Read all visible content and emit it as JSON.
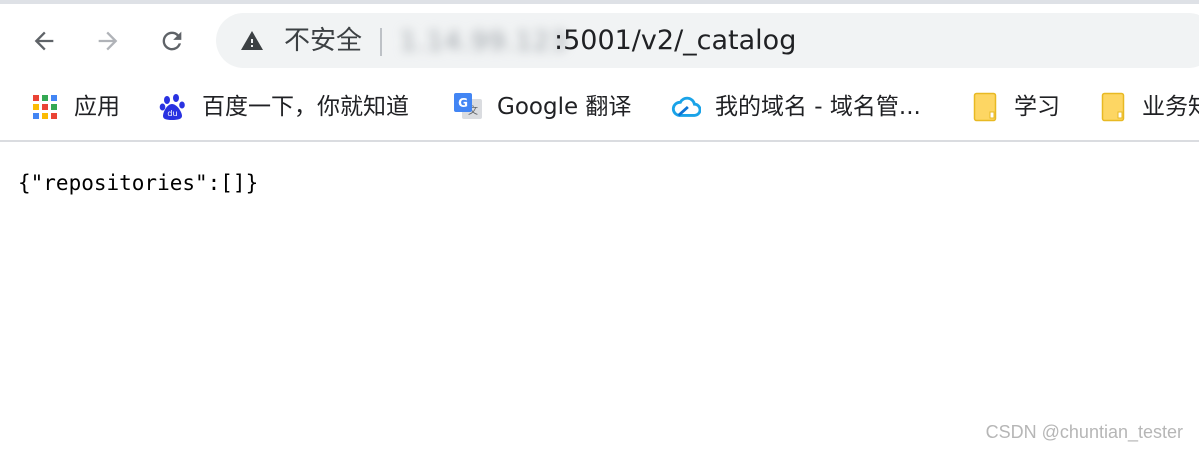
{
  "browser": {
    "address_bar": {
      "security_label": "不安全",
      "host_blurred": "1.14.99.123",
      "path": ":5001/v2/_catalog"
    },
    "bookmarks": [
      {
        "label": "应用",
        "icon": "apps-grid-icon"
      },
      {
        "label": "百度一下，你就知道",
        "icon": "baidu-paw-icon"
      },
      {
        "label": "Google 翻译",
        "icon": "google-translate-icon"
      },
      {
        "label": "我的域名 - 域名管...",
        "icon": "cloud-icon"
      },
      {
        "label": "学习",
        "icon": "folder-icon"
      },
      {
        "label": "业务知",
        "icon": "folder-icon"
      }
    ]
  },
  "page": {
    "json_text": "{\"repositories\":[]}"
  },
  "watermark": {
    "text": "CSDN @chuntian_tester"
  },
  "colors": {
    "toolbar_bg": "#ffffff",
    "omnibox_bg": "#f1f3f4",
    "icon_gray": "#5f6368",
    "disabled_gray": "#b0b3b8",
    "folder_yellow": "#fdd663"
  }
}
